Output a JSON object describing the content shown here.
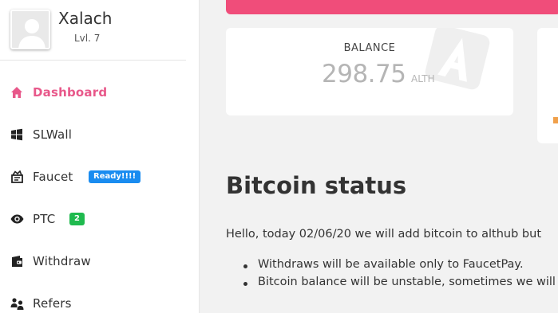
{
  "profile": {
    "username": "Xalach",
    "level": "Lvl. 7"
  },
  "nav": {
    "items": [
      {
        "label": "Dashboard",
        "icon": "home-icon",
        "active": true
      },
      {
        "label": "SLWall",
        "icon": "windows-icon"
      },
      {
        "label": "Faucet",
        "icon": "faucet-icon",
        "badge": "Ready!!!!"
      },
      {
        "label": "PTC",
        "icon": "eye-icon",
        "badge": "2"
      },
      {
        "label": "Withdraw",
        "icon": "wallet-icon"
      },
      {
        "label": "Refers",
        "icon": "users-icon"
      }
    ]
  },
  "balance": {
    "label": "BALANCE",
    "value": "298.75",
    "unit": "ALTH",
    "watermark_icon": "althub-logo-icon"
  },
  "status": {
    "title": "Bitcoin status",
    "text": "Hello, today 02/06/20 we will add bitcoin to althub but",
    "bullets": [
      "Withdraws will be available only to FaucetPay.",
      "Bitcoin balance will be unstable, sometimes we will"
    ]
  },
  "colors": {
    "accent": "#e8588a",
    "banner": "#f04d7a",
    "badge_blue": "#1a8cf0",
    "badge_green": "#1fba4e"
  }
}
